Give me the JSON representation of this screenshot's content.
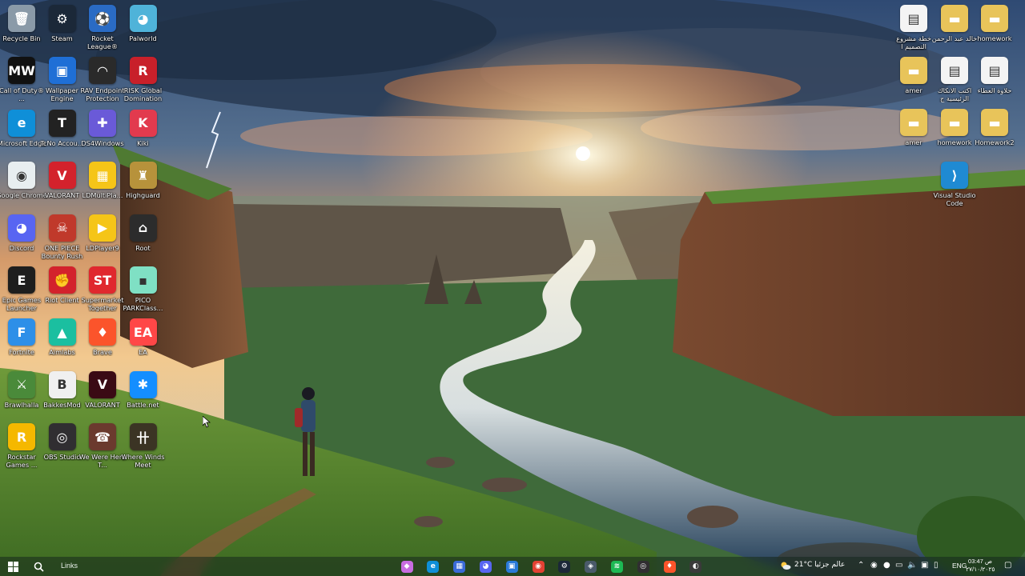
{
  "desktop": {
    "left_icons": [
      {
        "label": "Recycle Bin",
        "icon": "recycle-bin-icon",
        "color": "#8a9aa8",
        "glyph": "🗑"
      },
      {
        "label": "Steam",
        "icon": "steam-icon",
        "color": "#1b2838",
        "glyph": "⚙"
      },
      {
        "label": "Rocket League®",
        "icon": "rocket-league-icon",
        "color": "#2a6bc4",
        "glyph": "⚽"
      },
      {
        "label": "Palworld",
        "icon": "palworld-icon",
        "color": "#4fb3d9",
        "glyph": "◕"
      },
      {
        "label": "Call of Duty® ...",
        "icon": "call-of-duty-icon",
        "color": "#111111",
        "glyph": "MW"
      },
      {
        "label": "Wallpaper Engine",
        "icon": "wallpaper-engine-icon",
        "color": "#1f6fd6",
        "glyph": "▣"
      },
      {
        "label": "RAV Endpoint Protection",
        "icon": "rav-endpoint-icon",
        "color": "#2a2a2a",
        "glyph": "◠"
      },
      {
        "label": "RISK Global Domination",
        "icon": "risk-icon",
        "color": "#c8202a",
        "glyph": "R"
      },
      {
        "label": "Microsoft Edge",
        "icon": "edge-icon",
        "color": "#0f8fd8",
        "glyph": "e"
      },
      {
        "label": "TcNo Accou...",
        "icon": "tcno-icon",
        "color": "#222222",
        "glyph": "T"
      },
      {
        "label": "DS4Windows",
        "icon": "ds4windows-icon",
        "color": "#6a5ad8",
        "glyph": "✚"
      },
      {
        "label": "Kiki",
        "icon": "kiki-icon",
        "color": "#e23a4e",
        "glyph": "K"
      },
      {
        "label": "Google Chrome",
        "icon": "chrome-icon",
        "color": "#e8eef0",
        "glyph": "◉"
      },
      {
        "label": "VALORANT",
        "icon": "valorant-icon",
        "color": "#d3222c",
        "glyph": "V"
      },
      {
        "label": "LDMultiPla...",
        "icon": "ldmultiplayer-icon",
        "color": "#f5c518",
        "glyph": "▦"
      },
      {
        "label": "Highguard",
        "icon": "highguard-icon",
        "color": "#b7923b",
        "glyph": "♜"
      },
      {
        "label": "Discord",
        "icon": "discord-icon",
        "color": "#5865f2",
        "glyph": "◕"
      },
      {
        "label": "ONE PIECE Bounty Rush",
        "icon": "one-piece-icon",
        "color": "#c0392b",
        "glyph": "☠"
      },
      {
        "label": "LDPlayer9",
        "icon": "ldplayer-icon",
        "color": "#f5c518",
        "glyph": "▶"
      },
      {
        "label": "Root",
        "icon": "root-icon",
        "color": "#2c2c2c",
        "glyph": "⌂"
      },
      {
        "label": "Epic Games Launcher",
        "icon": "epic-games-icon",
        "color": "#1e1e1e",
        "glyph": "E"
      },
      {
        "label": "Riot Client",
        "icon": "riot-client-icon",
        "color": "#d3222c",
        "glyph": "✊"
      },
      {
        "label": "Supermarket Together",
        "icon": "supermarket-icon",
        "color": "#e0282e",
        "glyph": "ST"
      },
      {
        "label": "PICO PARKClass...",
        "icon": "pico-park-icon",
        "color": "#7fe0c4",
        "glyph": "▪"
      },
      {
        "label": "Fortnite",
        "icon": "fortnite-icon",
        "color": "#2d8fe8",
        "glyph": "F"
      },
      {
        "label": "Aimlabs",
        "icon": "aimlabs-icon",
        "color": "#1bbfa0",
        "glyph": "▲"
      },
      {
        "label": "Brave",
        "icon": "brave-icon",
        "color": "#fb542b",
        "glyph": "♦"
      },
      {
        "label": "EA",
        "icon": "ea-icon",
        "color": "#ff4747",
        "glyph": "EA"
      },
      {
        "label": "Brawlhalla",
        "icon": "brawlhalla-icon",
        "color": "#4a8a3a",
        "glyph": "⚔"
      },
      {
        "label": "BakkesMod",
        "icon": "bakkesmod-icon",
        "color": "#f0f0f0",
        "glyph": "B"
      },
      {
        "label": "VALORANT",
        "icon": "valorant-icon",
        "color": "#3a0a14",
        "glyph": "V"
      },
      {
        "label": "Battle.net",
        "icon": "battlenet-icon",
        "color": "#148eff",
        "glyph": "✱"
      },
      {
        "label": "Rockstar Games ...",
        "icon": "rockstar-icon",
        "color": "#f5b800",
        "glyph": "R"
      },
      {
        "label": "OBS Studio",
        "icon": "obs-icon",
        "color": "#302e31",
        "glyph": "◎"
      },
      {
        "label": "We Were Here T...",
        "icon": "we-were-here-icon",
        "color": "#6b3a2e",
        "glyph": "☎"
      },
      {
        "label": "Where Winds Meet",
        "icon": "where-winds-meet-icon",
        "color": "#3b3424",
        "glyph": "卄"
      }
    ],
    "right_icons": [
      {
        "label": "خطة مشروع التصميم ا",
        "icon": "document-icon",
        "color": "#f4f4f4",
        "glyph": "▤"
      },
      {
        "label": "خالد عبد الرحمن",
        "icon": "folder-icon",
        "color": "#e8c45a",
        "glyph": "▬"
      },
      {
        "label": "homework",
        "icon": "folder-icon",
        "color": "#e8c45a",
        "glyph": "▬"
      },
      {
        "label": "amer",
        "icon": "folder-icon",
        "color": "#e8c45a",
        "glyph": "▬"
      },
      {
        "label": "اكتب الانكاك الرئيسية ج",
        "icon": "document-icon",
        "color": "#f4f4f4",
        "glyph": "▤"
      },
      {
        "label": "حلاوة العطاء",
        "icon": "document-icon",
        "color": "#f4f4f4",
        "glyph": "▤"
      },
      {
        "label": "amer",
        "icon": "folder-icon",
        "color": "#e8c45a",
        "glyph": "▬"
      },
      {
        "label": "homework",
        "icon": "folder-icon",
        "color": "#e8c45a",
        "glyph": "▬"
      },
      {
        "label": "Homework2",
        "icon": "folder-icon",
        "color": "#e8c45a",
        "glyph": "▬"
      },
      {
        "label": "Visual Studio Code",
        "icon": "vscode-icon",
        "color": "#1f8ad2",
        "glyph": "⟩"
      }
    ]
  },
  "taskbar": {
    "start_icon": "windows-start-icon",
    "search_icon": "search-icon",
    "links_label": "Links",
    "pinned": [
      {
        "name": "copilot-icon",
        "color": "#c86de0",
        "glyph": "◆"
      },
      {
        "name": "edge-icon",
        "color": "#0f8fd8",
        "glyph": "e"
      },
      {
        "name": "calendar-icon",
        "color": "#3a6ad8",
        "glyph": "▦"
      },
      {
        "name": "discord-icon",
        "color": "#5865f2",
        "glyph": "◕"
      },
      {
        "name": "photos-icon",
        "color": "#2a7ad8",
        "glyph": "▣"
      },
      {
        "name": "chrome-icon",
        "color": "#e34133",
        "glyph": "◉"
      },
      {
        "name": "steam-icon",
        "color": "#1b2838",
        "glyph": "⚙"
      },
      {
        "name": "app-icon",
        "color": "#4a5a6a",
        "glyph": "◈"
      },
      {
        "name": "spotify-icon",
        "color": "#1db954",
        "glyph": "≋"
      },
      {
        "name": "obs-icon",
        "color": "#302e31",
        "glyph": "◎"
      },
      {
        "name": "brave-icon",
        "color": "#fb542b",
        "glyph": "♦"
      },
      {
        "name": "media-icon",
        "color": "#3a3a3a",
        "glyph": "◐"
      }
    ],
    "weather": "21°C  عالم جزئيا",
    "language": "ENG",
    "clock_time": "03:47 ص",
    "clock_date": "٢٧/١٠/٢٠٢٥"
  }
}
